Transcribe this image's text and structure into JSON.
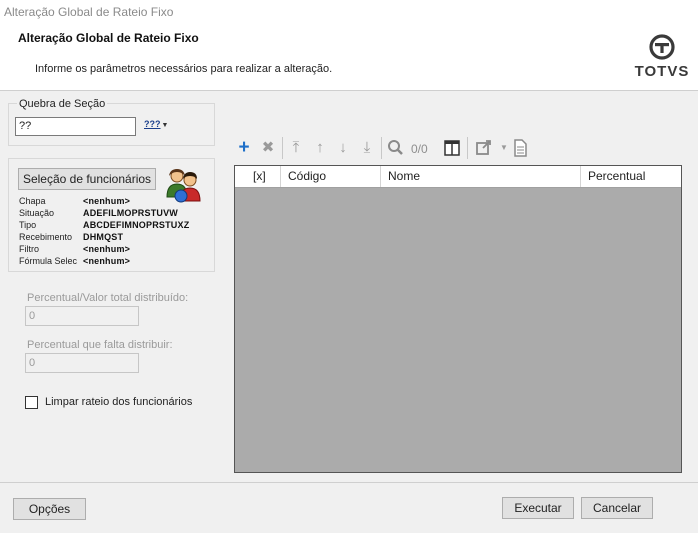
{
  "window": {
    "title": "Alteração Global de Rateio Fixo"
  },
  "header": {
    "title": "Alteração Global de Rateio Fixo",
    "subtitle": "Informe os parâmetros necessários para realizar a alteração.",
    "logo_text": "TOTVS"
  },
  "section_break": {
    "legend": "Quebra de Seção",
    "value": "??",
    "lookup_label": "???"
  },
  "employees": {
    "button_label": "Seleção de funcionários",
    "properties": [
      {
        "label": "Chapa",
        "value": "<nenhum>"
      },
      {
        "label": "Situação",
        "value": "ADEFILMOPRSTUVW"
      },
      {
        "label": "Tipo",
        "value": "ABCDEFIMNOPRSTUXZ"
      },
      {
        "label": "Recebimento",
        "value": "DHMQST"
      },
      {
        "label": "Filtro",
        "value": "<nenhum>"
      },
      {
        "label": "Fórmula Selec",
        "value": "<nenhum>"
      }
    ]
  },
  "fields": {
    "total_label": "Percentual/Valor total distribuído:",
    "total_value": "0",
    "remaining_label": "Percentual que falta distribuir:",
    "remaining_value": "0"
  },
  "clear_checkbox": {
    "label": "Limpar rateio dos funcionários",
    "checked": false
  },
  "toolbar": {
    "record_count": "0/0"
  },
  "grid": {
    "columns": [
      "[x]",
      "Código",
      "Nome",
      "Percentual"
    ],
    "rows": []
  },
  "footer": {
    "options_label": "Opções",
    "execute_label": "Executar",
    "cancel_label": "Cancelar"
  },
  "colors": {
    "add_icon": "#1e6fc8",
    "grid_background": "#ababab",
    "disabled_text": "#9a9a9a"
  }
}
